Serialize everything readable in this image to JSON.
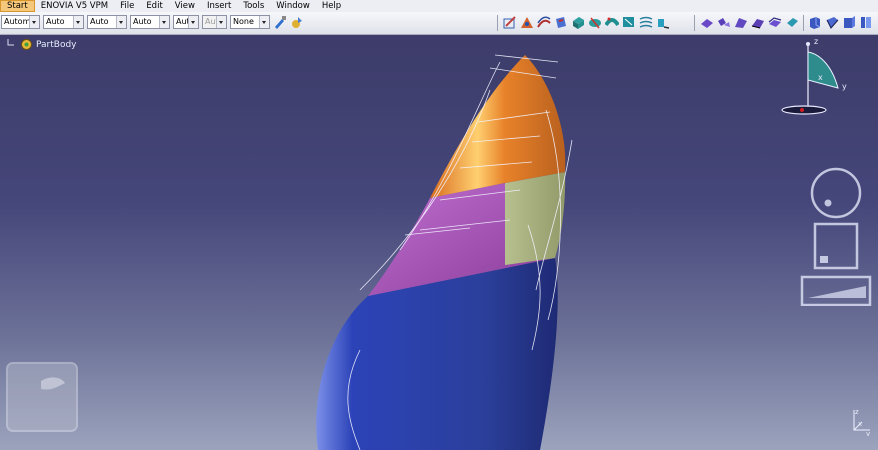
{
  "menubar": {
    "items": [
      {
        "label": "Start",
        "active": true
      },
      {
        "label": "ENOVIA V5 VPM"
      },
      {
        "label": "File"
      },
      {
        "label": "Edit"
      },
      {
        "label": "View"
      },
      {
        "label": "Insert"
      },
      {
        "label": "Tools"
      },
      {
        "label": "Window"
      },
      {
        "label": "Help"
      }
    ]
  },
  "toolbar": {
    "combos": [
      {
        "value": "Automa"
      },
      {
        "value": "Auto"
      },
      {
        "value": "Auto"
      },
      {
        "value": "Auto"
      },
      {
        "value": "Aut"
      },
      {
        "value": "Aut",
        "disabled": true
      },
      {
        "value": "None"
      }
    ]
  },
  "tree": {
    "root_label": "PartBody"
  },
  "compass": {
    "axis_x": "x",
    "axis_y": "y",
    "axis_z": "z"
  },
  "triad": {
    "axis_x": "x",
    "axis_y": "y",
    "axis_z": "z"
  },
  "colors": {
    "viewport_top": "#3b3a66",
    "viewport_bottom": "#9ba3bd",
    "surface_blue": "#2b3f9a",
    "surface_purple": "#a04cae",
    "surface_orange": "#e8822a",
    "surface_green": "#a6b07a"
  }
}
